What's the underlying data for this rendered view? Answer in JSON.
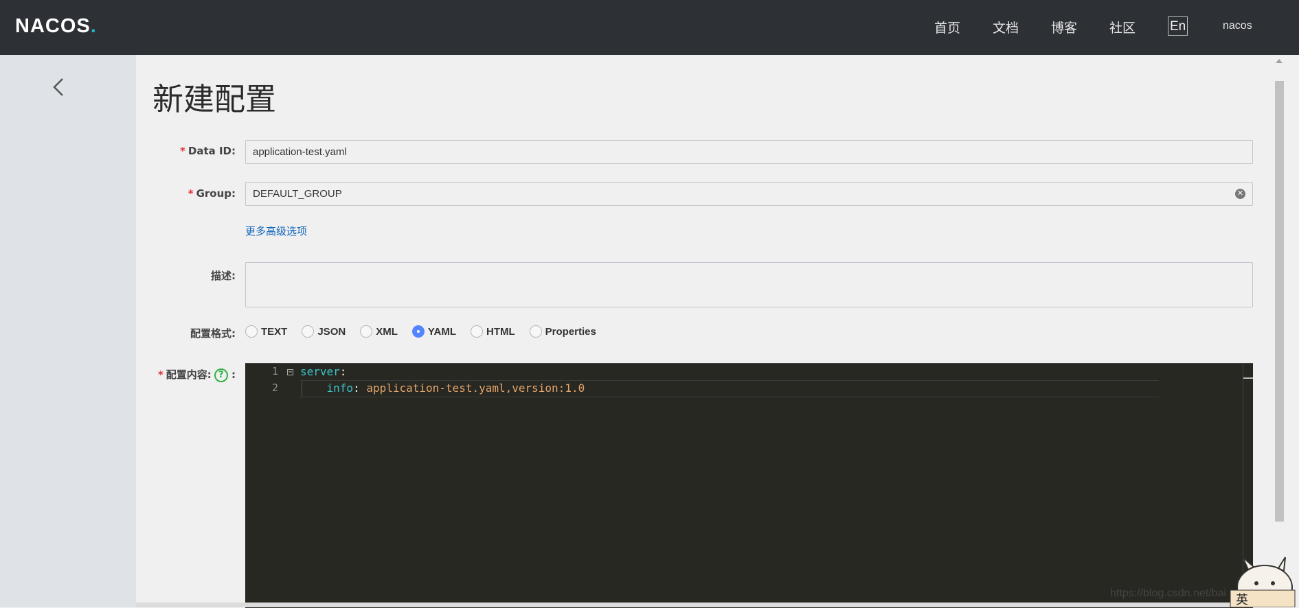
{
  "brand": {
    "logo_text": "NACOS",
    "logo_dot": "."
  },
  "nav": {
    "home": "首页",
    "docs": "文档",
    "blog": "博客",
    "community": "社区",
    "lang": "En",
    "user": "nacos"
  },
  "page": {
    "title": "新建配置"
  },
  "form": {
    "data_id": {
      "label": "Data ID:",
      "value": "application-test.yaml"
    },
    "group": {
      "label": "Group:",
      "value": "DEFAULT_GROUP"
    },
    "advanced_link": "更多高级选项",
    "description": {
      "label": "描述:",
      "value": ""
    },
    "format": {
      "label": "配置格式:",
      "options": [
        "TEXT",
        "JSON",
        "XML",
        "YAML",
        "HTML",
        "Properties"
      ],
      "selected": "YAML"
    },
    "content": {
      "label": "配置内容:",
      "colon": ":",
      "line_numbers": [
        "1",
        "2"
      ],
      "lines": [
        {
          "key": "server",
          "punc": ":",
          "value": ""
        },
        {
          "key": "info",
          "punc": ": ",
          "value": "application-test.yaml,version:1.0"
        }
      ]
    }
  },
  "watermark": "https://blog.csdn.net/bai",
  "ime": {
    "label": "英"
  },
  "colors": {
    "topbar": "#2d3035",
    "accent": "#5584ff",
    "link": "#1264bd",
    "required": "#e0393e",
    "editor_bg": "#272822"
  }
}
